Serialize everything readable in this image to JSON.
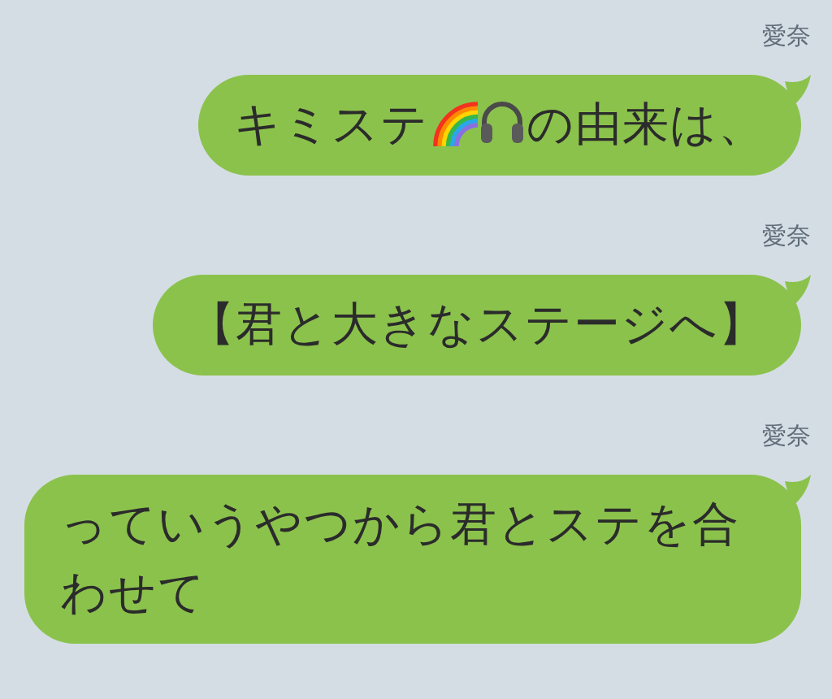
{
  "messages": [
    {
      "sender": "愛奈",
      "parts": [
        {
          "kind": "text",
          "text": "キミステ"
        },
        {
          "kind": "rainbow"
        },
        {
          "kind": "headphones"
        },
        {
          "kind": "text",
          "text": "の由来は、"
        }
      ]
    },
    {
      "sender": "愛奈",
      "parts": [
        {
          "kind": "text",
          "text": "【君と大きなステージへ】"
        }
      ]
    },
    {
      "sender": "愛奈",
      "parts": [
        {
          "kind": "text",
          "text": "っていうやつから君とステを合わせて"
        }
      ]
    }
  ]
}
